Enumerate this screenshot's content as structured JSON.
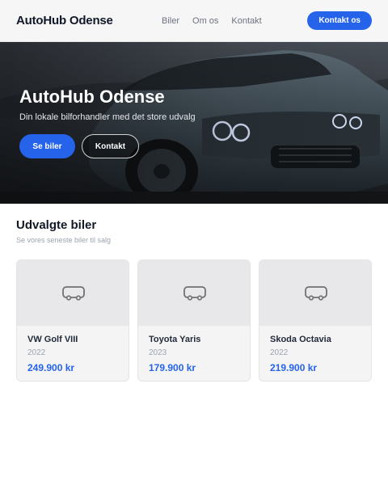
{
  "nav": {
    "brand": "AutoHub Odense",
    "links": [
      "Biler",
      "Om os",
      "Kontakt"
    ],
    "cta": "Kontakt os"
  },
  "hero": {
    "title": "AutoHub Odense",
    "subtitle": "Din lokale bilforhandler med det store udvalg",
    "primary_button": "Se biler",
    "secondary_button": "Kontakt"
  },
  "featured": {
    "title": "Udvalgte biler",
    "subtitle": "Se vores seneste biler til salg",
    "cars": [
      {
        "name": "VW Golf VIII",
        "year": "2022",
        "price": "249.900 kr",
        "icon": "car-icon"
      },
      {
        "name": "Toyota Yaris",
        "year": "2023",
        "price": "179.900 kr",
        "icon": "car-icon"
      },
      {
        "name": "Skoda Octavia",
        "year": "2022",
        "price": "219.900 kr",
        "icon": "car-icon"
      }
    ]
  },
  "colors": {
    "accent": "#2563eb",
    "nav_background": "#f6f6f7",
    "card_background": "#f4f4f5"
  }
}
